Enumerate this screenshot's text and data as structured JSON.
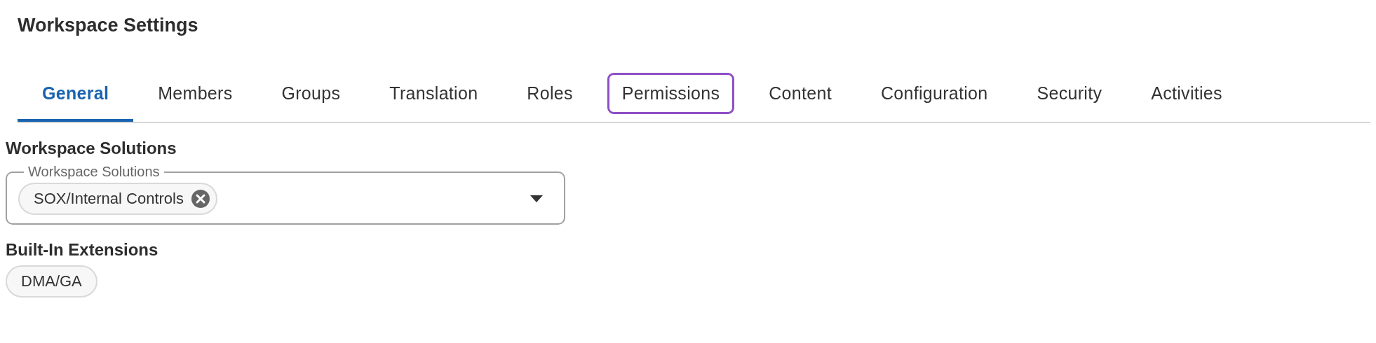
{
  "page_title": "Workspace Settings",
  "tabs": [
    {
      "label": "General",
      "selected": true,
      "focused": false
    },
    {
      "label": "Members",
      "selected": false,
      "focused": false
    },
    {
      "label": "Groups",
      "selected": false,
      "focused": false
    },
    {
      "label": "Translation",
      "selected": false,
      "focused": false
    },
    {
      "label": "Roles",
      "selected": false,
      "focused": false
    },
    {
      "label": "Permissions",
      "selected": false,
      "focused": true
    },
    {
      "label": "Content",
      "selected": false,
      "focused": false
    },
    {
      "label": "Configuration",
      "selected": false,
      "focused": false
    },
    {
      "label": "Security",
      "selected": false,
      "focused": false
    },
    {
      "label": "Activities",
      "selected": false,
      "focused": false
    }
  ],
  "sections": [
    {
      "heading": "Workspace Solutions",
      "kind": "select",
      "field_label": "Workspace Solutions",
      "chips": [
        "SOX/Internal Controls"
      ]
    },
    {
      "heading": "Built-In Extensions",
      "kind": "chips",
      "chips": [
        "DMA/GA"
      ]
    }
  ]
}
